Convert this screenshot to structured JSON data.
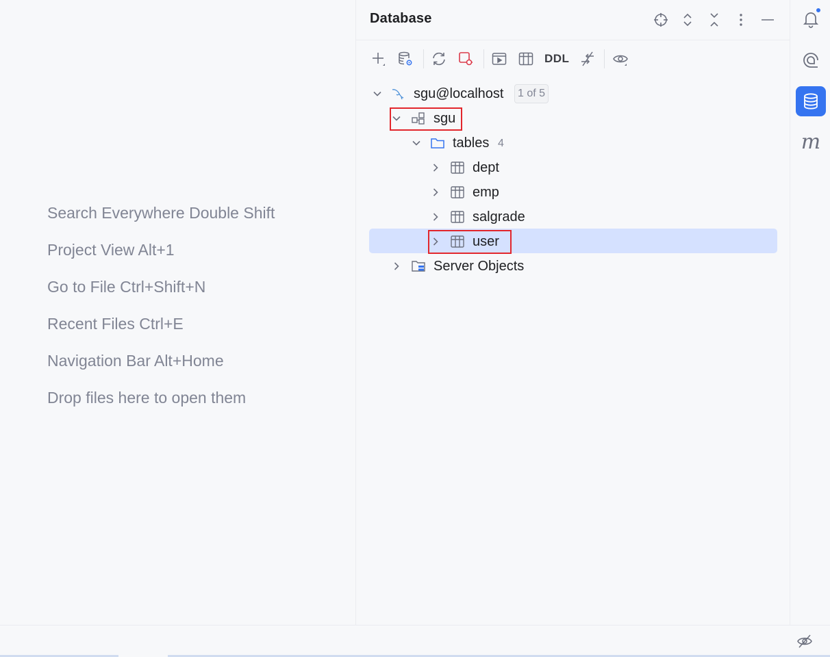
{
  "editor": {
    "hints": [
      "Search Everywhere Double Shift",
      "Project View Alt+1",
      "Go to File Ctrl+Shift+N",
      "Recent Files Ctrl+E",
      "Navigation Bar Alt+Home",
      "Drop files here to open them"
    ]
  },
  "db_panel": {
    "title": "Database",
    "header_icons": [
      "locate-icon",
      "expand-all-icon",
      "collapse-all-icon",
      "more-options-icon",
      "minimize-icon"
    ],
    "toolbar": {
      "icons": [
        "add-icon",
        "data-source-properties-icon",
        "refresh-icon",
        "disconnect-icon",
        "jump-to-console-icon",
        "edit-data-icon",
        "compare-icon",
        "view-options-icon"
      ],
      "ddl_label": "DDL"
    },
    "tree": {
      "connection": {
        "label": "sgu@localhost",
        "badge": "1 of 5"
      },
      "schema": {
        "label": "sgu"
      },
      "tables_folder": {
        "label": "tables",
        "count": "4"
      },
      "tables": [
        "dept",
        "emp",
        "salgrade",
        "user"
      ],
      "server_objects": {
        "label": "Server Objects"
      }
    },
    "selected_item": "user"
  },
  "right_stripe": {
    "buttons": [
      "notifications-icon",
      "ai-assistant-icon",
      "database-icon",
      "maven-icon"
    ],
    "active": "database-icon",
    "maven_glyph": "m"
  },
  "status_bar": {
    "icons": [
      "power-save-mode-icon"
    ]
  },
  "colors": {
    "accent": "#3574f0",
    "selection": "#d5e1ff",
    "highlight_box": "#e2262c",
    "hint_text": "#818594"
  }
}
